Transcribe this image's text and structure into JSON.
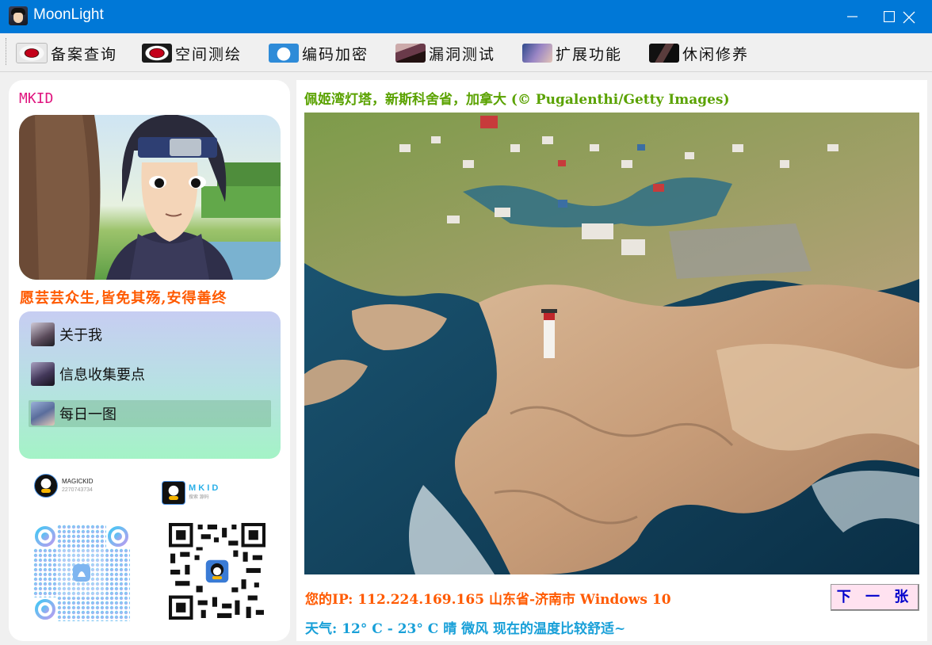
{
  "window": {
    "title": "MoonLight"
  },
  "menu": [
    {
      "label": "备案查询",
      "icon": "sharingan-eye-icon"
    },
    {
      "label": "空间测绘",
      "icon": "sharingan-eye-icon"
    },
    {
      "label": "编码加密",
      "icon": "doraemon-icon"
    },
    {
      "label": "漏洞测试",
      "icon": "sharingan-eye-icon"
    },
    {
      "label": "扩展功能",
      "icon": "anime-girl-icon"
    },
    {
      "label": "休闲修养",
      "icon": "anime-character-icon"
    }
  ],
  "sidebar": {
    "brand": "MKID",
    "slogan": "愿芸芸众生,皆免其殇,安得善终",
    "nav": [
      {
        "label": "关于我",
        "active": false
      },
      {
        "label": "信息收集要点",
        "active": false
      },
      {
        "label": "每日一图",
        "active": true
      }
    ],
    "qq_cards": [
      {
        "name": "MAGICKID",
        "number": "2270743734"
      },
      {
        "name": "M K I D",
        "sub": "搜索 源码"
      }
    ]
  },
  "main": {
    "caption": "佩姬湾灯塔，新斯科舍省，加拿大 (© Pugalenthi/Getty Images)",
    "ip_line": "您的IP: 112.224.169.165 山东省-济南市 Windows 10",
    "weather": "天气: 12° C - 23° C 晴 微风 现在的温度比较舒适~",
    "next_button": "下 一 张"
  },
  "colors": {
    "titlebar": "#0078d7",
    "brand": "#e0157f",
    "slogan": "#ff5a00",
    "caption": "#5aa200",
    "ip": "#ff5a00",
    "weather": "#19a0d8",
    "next_button_text": "#0000cc"
  }
}
